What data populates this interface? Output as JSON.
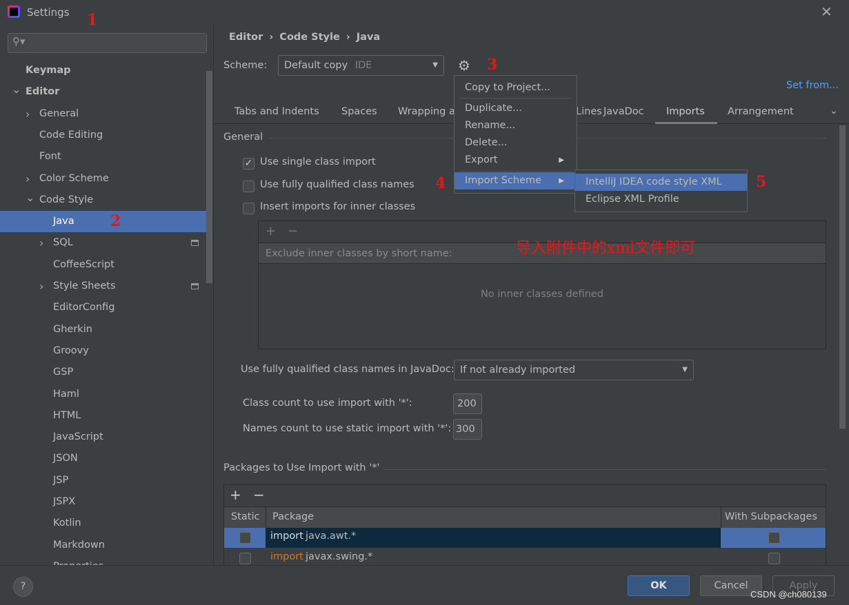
{
  "window": {
    "title": "Settings",
    "close_icon": "close-icon",
    "app_icon": "intellij-idea-icon"
  },
  "search": {
    "placeholder": "",
    "value": ""
  },
  "sidebar": {
    "items": [
      {
        "label": "Keymap",
        "level": 0,
        "bold": true
      },
      {
        "label": "Editor",
        "level": 0,
        "bold": true,
        "arrow": "expanded"
      },
      {
        "label": "General",
        "level": 1,
        "arrow": "collapsed"
      },
      {
        "label": "Code Editing",
        "level": 1
      },
      {
        "label": "Font",
        "level": 1
      },
      {
        "label": "Color Scheme",
        "level": 1,
        "arrow": "collapsed"
      },
      {
        "label": "Code Style",
        "level": 1,
        "arrow": "expanded"
      },
      {
        "label": "Java",
        "level": 2,
        "selected": true
      },
      {
        "label": "SQL",
        "level": 2,
        "arrow": "collapsed",
        "project_icon": true
      },
      {
        "label": "CoffeeScript",
        "level": 2
      },
      {
        "label": "Style Sheets",
        "level": 2,
        "arrow": "collapsed",
        "project_icon": true
      },
      {
        "label": "EditorConfig",
        "level": 2
      },
      {
        "label": "Gherkin",
        "level": 2
      },
      {
        "label": "Groovy",
        "level": 2
      },
      {
        "label": "GSP",
        "level": 2
      },
      {
        "label": "Haml",
        "level": 2
      },
      {
        "label": "HTML",
        "level": 2
      },
      {
        "label": "JavaScript",
        "level": 2
      },
      {
        "label": "JSON",
        "level": 2
      },
      {
        "label": "JSP",
        "level": 2
      },
      {
        "label": "JSPX",
        "level": 2
      },
      {
        "label": "Kotlin",
        "level": 2
      },
      {
        "label": "Markdown",
        "level": 2
      },
      {
        "label": "Properties",
        "level": 2
      }
    ]
  },
  "breadcrumb": [
    "Editor",
    "Code Style",
    "Java"
  ],
  "scheme": {
    "label": "Scheme:",
    "value": "Default copy",
    "scope": "IDE",
    "set_from": "Set from..."
  },
  "tabs": [
    {
      "label": "Tabs and Indents"
    },
    {
      "label": "Spaces"
    },
    {
      "label": "Wrapping and Braces"
    },
    {
      "label": "Blank Lines"
    },
    {
      "label": "JavaDoc"
    },
    {
      "label": "Imports",
      "active": true
    },
    {
      "label": "Arrangement"
    }
  ],
  "gear_menu": {
    "items": [
      "Copy to Project...",
      "Duplicate...",
      "Rename...",
      "Delete...",
      "Export",
      "Import Scheme"
    ],
    "highlighted": "Import Scheme"
  },
  "import_submenu": {
    "items": [
      "IntelliJ IDEA code style XML",
      "Eclipse XML Profile"
    ],
    "highlighted": "IntelliJ IDEA code style XML"
  },
  "general": {
    "title": "General",
    "options": [
      {
        "label": "Use single class import",
        "checked": true
      },
      {
        "label": "Use fully qualified class names",
        "checked": false
      },
      {
        "label": "Insert imports for inner classes",
        "checked": false
      }
    ],
    "inner_table": {
      "header": "Exclude inner classes by short name:",
      "empty": "No inner classes defined"
    },
    "javadoc": {
      "label": "Use fully qualified class names in JavaDoc:",
      "value": "If not already imported"
    },
    "class_count": {
      "label": "Class count to use import with '*':",
      "value": "200"
    },
    "names_count": {
      "label": "Names count to use static import with '*':",
      "value": "300"
    }
  },
  "packages": {
    "title": "Packages to Use Import with '*'",
    "columns": [
      "Static",
      "Package",
      "With Subpackages"
    ],
    "rows": [
      {
        "keyword": "import",
        "package": "java.awt.*",
        "static": false,
        "subpackages": false,
        "selected": true
      },
      {
        "keyword": "import",
        "package": "javax.swing.*",
        "static": false,
        "subpackages": false
      }
    ]
  },
  "footer": {
    "help": "?",
    "ok": "OK",
    "cancel": "Cancel",
    "apply": "Apply"
  },
  "annotations": {
    "n1": "1",
    "n2": "2",
    "n3": "3",
    "n4": "4",
    "n5": "5",
    "note": "导入附件中的xml文件即可"
  },
  "watermark": "CSDN @ch080139",
  "colors": {
    "selection": "#4b6eaf",
    "link": "#589df6",
    "annotation": "#e8161a",
    "keyword": "#cc7832"
  }
}
